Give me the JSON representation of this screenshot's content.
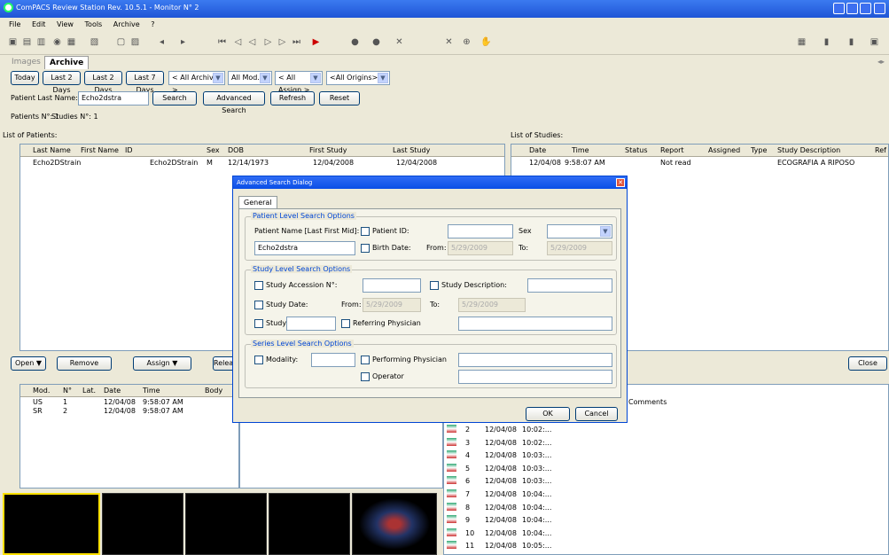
{
  "window": {
    "title": "ComPACS Review Station Rev. 10.5.1 - Monitor N° 2"
  },
  "menu": [
    "File",
    "Edit",
    "View",
    "Tools",
    "Archive",
    "?"
  ],
  "tabs": {
    "images": "Images",
    "archive": "Archive"
  },
  "filters": {
    "today": "Today",
    "last2a": "Last 2 Days",
    "last2b": "Last 2 Days",
    "last7": "Last 7 Days",
    "archives": "< All Archives >",
    "modality": "All Mod.",
    "assign": "< All Assign.>",
    "origins": "<All Origins>"
  },
  "search": {
    "label": "Patient Last Name:",
    "value": "Echo2dstra",
    "search": "Search",
    "advanced": "Advanced Search",
    "refresh": "Refresh",
    "reset": "Reset"
  },
  "counts": {
    "patients": "Patients N°: 1",
    "studies": "Studies N°: 1"
  },
  "patients": {
    "title": "List of Patients:",
    "columns": [
      "Last Name",
      "First Name",
      "ID",
      "Sex",
      "DOB",
      "First Study",
      "Last Study"
    ],
    "rows": [
      [
        "Echo2DStrain",
        "",
        "Echo2DStrain",
        "M",
        "12/14/1973",
        "12/04/2008",
        "12/04/2008"
      ]
    ]
  },
  "studies": {
    "title": "List of Studies:",
    "columns": [
      "Date",
      "Time",
      "Status",
      "Report",
      "Assigned",
      "Type",
      "Study Description",
      "Ref"
    ],
    "rows": [
      [
        "12/04/08",
        "9:58:07 AM",
        "",
        "Not read",
        "",
        "",
        "ECOGRAFIA A RIPOSO"
      ]
    ]
  },
  "buttons": {
    "open": "Open",
    "remove": "Remove",
    "assign": "Assign",
    "release": "Release",
    "close": "Close"
  },
  "series": {
    "columns": [
      "Mod.",
      "N°",
      "Lat.",
      "Date",
      "Time",
      "Body"
    ],
    "rows": [
      [
        "US",
        "1",
        "",
        "12/04/08",
        "9:58:07 AM"
      ],
      [
        "SR",
        "2",
        "",
        "12/04/08",
        "9:58:07 AM"
      ]
    ]
  },
  "images": {
    "comments": "Comments",
    "rows": [
      [
        "2",
        "12/04/08",
        "10:02:..."
      ],
      [
        "3",
        "12/04/08",
        "10:02:..."
      ],
      [
        "4",
        "12/04/08",
        "10:03:..."
      ],
      [
        "5",
        "12/04/08",
        "10:03:..."
      ],
      [
        "6",
        "12/04/08",
        "10:03:..."
      ],
      [
        "7",
        "12/04/08",
        "10:04:..."
      ],
      [
        "8",
        "12/04/08",
        "10:04:..."
      ],
      [
        "9",
        "12/04/08",
        "10:04:..."
      ],
      [
        "10",
        "12/04/08",
        "10:04:..."
      ],
      [
        "11",
        "12/04/08",
        "10:05:..."
      ]
    ]
  },
  "dialog": {
    "title": "Advanced Search Dialog",
    "tab": "General",
    "patient_group": "Patient Level Search Options",
    "patient_name_label": "Patient Name [Last First Mid]:",
    "patient_name_value": "Echo2dstra",
    "patient_id": "Patient ID:",
    "sex": "Sex",
    "birth_date": "Birth Date:",
    "from": "From:",
    "to": "To:",
    "date_value": "5/29/2009",
    "study_group": "Study Level Search Options",
    "study_accession": "Study Accession N°:",
    "study_description": "Study Description:",
    "study_date": "Study Date:",
    "study_id": "Study ID:",
    "referring": "Referring Physician",
    "series_group": "Series Level Search Options",
    "modality": "Modality:",
    "performing": "Performing Physician",
    "operator": "Operator",
    "ok": "OK",
    "cancel": "Cancel"
  }
}
